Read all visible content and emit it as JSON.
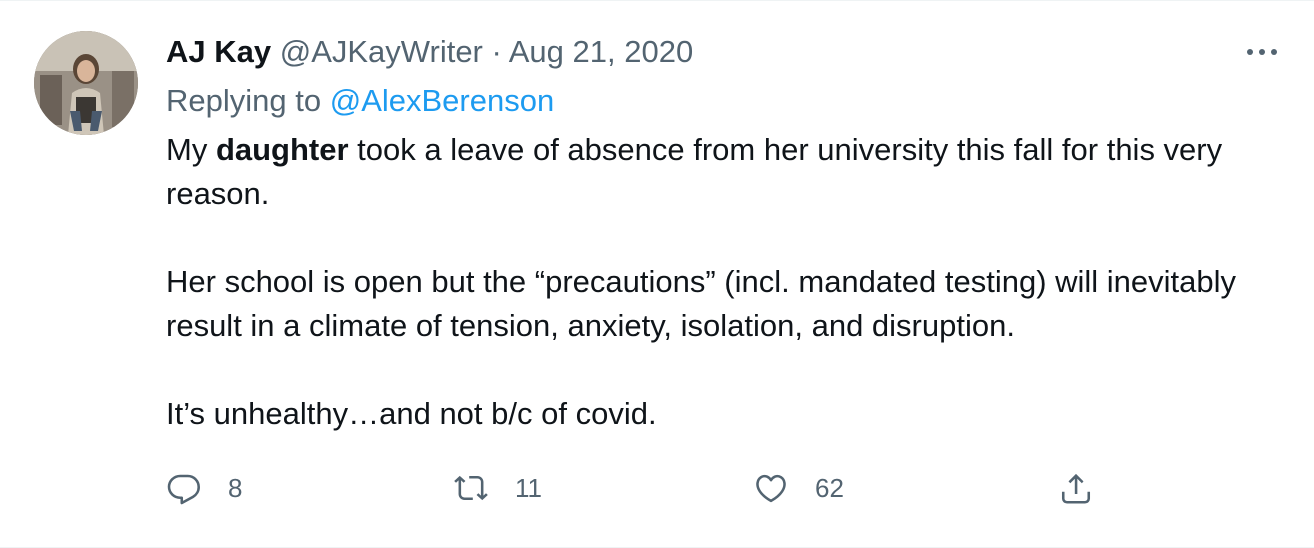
{
  "tweet": {
    "author_name": "AJ Kay",
    "handle": "@AJKayWriter",
    "separator": "·",
    "date": "Aug 21, 2020",
    "replying_prefix": "Replying to",
    "replying_to": "@AlexBerenson",
    "body": {
      "p1_pre": "My ",
      "p1_bold": "daughter",
      "p1_post": " took a leave of absence from her university this fall for this very reason.",
      "p2": "Her school is open but the “precautions” (incl. mandated testing) will inevitably result in a climate of tension, anxiety, isolation, and disruption.",
      "p3": "It’s unhealthy…and not b/c of covid."
    },
    "actions": {
      "reply_count": "8",
      "retweet_count": "11",
      "like_count": "62"
    }
  },
  "icons": {
    "more": "more-horizontal-icon",
    "reply": "reply-bubble-icon",
    "retweet": "retweet-icon",
    "like": "heart-icon",
    "share": "share-upload-icon"
  },
  "colors": {
    "text": "#0f1419",
    "secondary": "#536471",
    "accent": "#1d9bf0"
  }
}
